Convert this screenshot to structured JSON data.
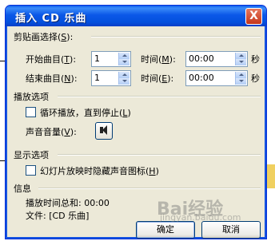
{
  "dialog": {
    "title": "插入 CD 乐曲",
    "close": "X"
  },
  "clip": {
    "group_label": "剪贴画选择",
    "group_key": "S",
    "start_label": "开始曲目",
    "start_key": "T",
    "start_track": "1",
    "start_time_label": "时间",
    "start_time_key": "M",
    "start_time": "00:00",
    "end_label": "结束曲目",
    "end_key": "N",
    "end_track": "1",
    "end_time_label": "时间",
    "end_time_key": "E",
    "end_time": "00:00",
    "seconds_unit": "秒"
  },
  "playback": {
    "group_label": "播放选项",
    "loop_label": "循环播放，直到停止",
    "loop_key": "L",
    "volume_label": "声音音量",
    "volume_key": "V"
  },
  "display": {
    "group_label": "显示选项",
    "hide_label": "幻灯片放映时隐藏声音图标",
    "hide_key": "H"
  },
  "info": {
    "group_label": "信息",
    "total_time_label": "播放时间总和: 00:00",
    "file_label": "文件: [CD 乐曲]"
  },
  "buttons": {
    "ok": "确定",
    "cancel": "取消"
  },
  "watermark": {
    "main": "Bai经验",
    "sub": "jingyan.baidu.com"
  },
  "colors": {
    "titlebar": "#0450dd",
    "face": "#ece9d8",
    "close": "#c5361a"
  }
}
